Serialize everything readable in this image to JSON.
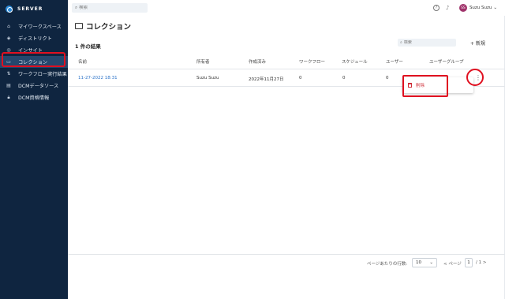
{
  "app": {
    "brand": "SERVER"
  },
  "sidebar": {
    "items": [
      {
        "label": "マイワークスペース",
        "icon": "home-icon"
      },
      {
        "label": "ディストリクト",
        "icon": "layers-icon"
      },
      {
        "label": "インサイト",
        "icon": "insight-icon"
      },
      {
        "label": "コレクション",
        "icon": "folder-icon",
        "active": true
      },
      {
        "label": "ワークフロー実行結果",
        "icon": "workflow-icon"
      },
      {
        "label": "DCMデータソース",
        "icon": "database-icon"
      },
      {
        "label": "DCM資格情報",
        "icon": "lock-icon"
      }
    ]
  },
  "topbar": {
    "search_placeholder": "検索",
    "user_initials": "SS",
    "user_name": "Suzu Suzu"
  },
  "main": {
    "title": "コレクション",
    "result_count": "1 件の結果",
    "search_placeholder": "検索",
    "new_label": "+ 新規",
    "columns": [
      "名前",
      "所有者",
      "作成済み",
      "ワークフロー",
      "スケジュール",
      "ユーザー",
      "ユーザーグループ"
    ],
    "rows": [
      {
        "name": "11-27-2022 18:31",
        "owner": "Suzu Suzu",
        "created": "2022年11月27日",
        "workflows": "0",
        "schedules": "0",
        "users": "0"
      }
    ],
    "row_menu": {
      "delete_label": "削除"
    }
  },
  "pagination": {
    "per_page_label": "ページあたりの行数:",
    "per_page_value": "10",
    "page_prefix": "< ページ",
    "current_page": "1",
    "page_suffix": "/ 1 >"
  },
  "colors": {
    "sidebar_bg": "#0f2540",
    "active_bg": "#24476d",
    "accent": "#2a72c8",
    "highlight": "#e01020",
    "avatar": "#a0336b"
  }
}
